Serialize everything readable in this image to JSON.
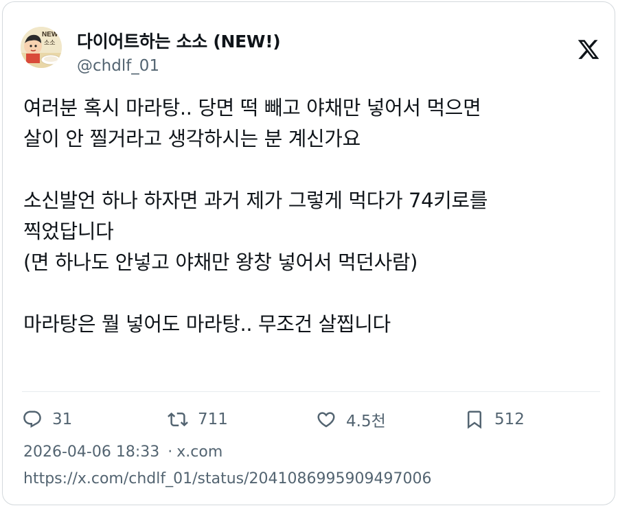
{
  "author": {
    "display_name": "다이어트하는 소소 (NEW!)",
    "handle": "@chdlf_01",
    "avatar_badge": "NEW",
    "avatar_badge2": "소소"
  },
  "tweet": {
    "lines": [
      "여러분 혹시 마라탕.. 당면 떡 빼고 야채만 넣어서 먹으면",
      "살이 안 찔거라고 생각하시는 분 계신가요",
      "",
      "소신발언 하나 하자면 과거 제가 그렇게 먹다가 74키로를",
      "찍었답니다",
      "(면 하나도 안넣고 야채만 왕창 넣어서 먹던사람)",
      "",
      "마라탕은 뭘 넣어도 마라탕.. 무조건 살찝니다"
    ]
  },
  "actions": {
    "reply_count": "31",
    "retweet_count": "711",
    "like_count": "4.5천",
    "bookmark_count": "512"
  },
  "meta": {
    "datetime": "2026-04-06 18:33",
    "source": "x.com",
    "url": "https://x.com/chdlf_01/status/2041086995909497006"
  },
  "icons": {
    "logo": "x-logo-icon",
    "reply": "reply-icon",
    "retweet": "retweet-icon",
    "like": "heart-icon",
    "bookmark": "bookmark-icon"
  },
  "colors": {
    "text": "#0f1419",
    "secondary": "#536471",
    "border": "#d3d8dc"
  }
}
